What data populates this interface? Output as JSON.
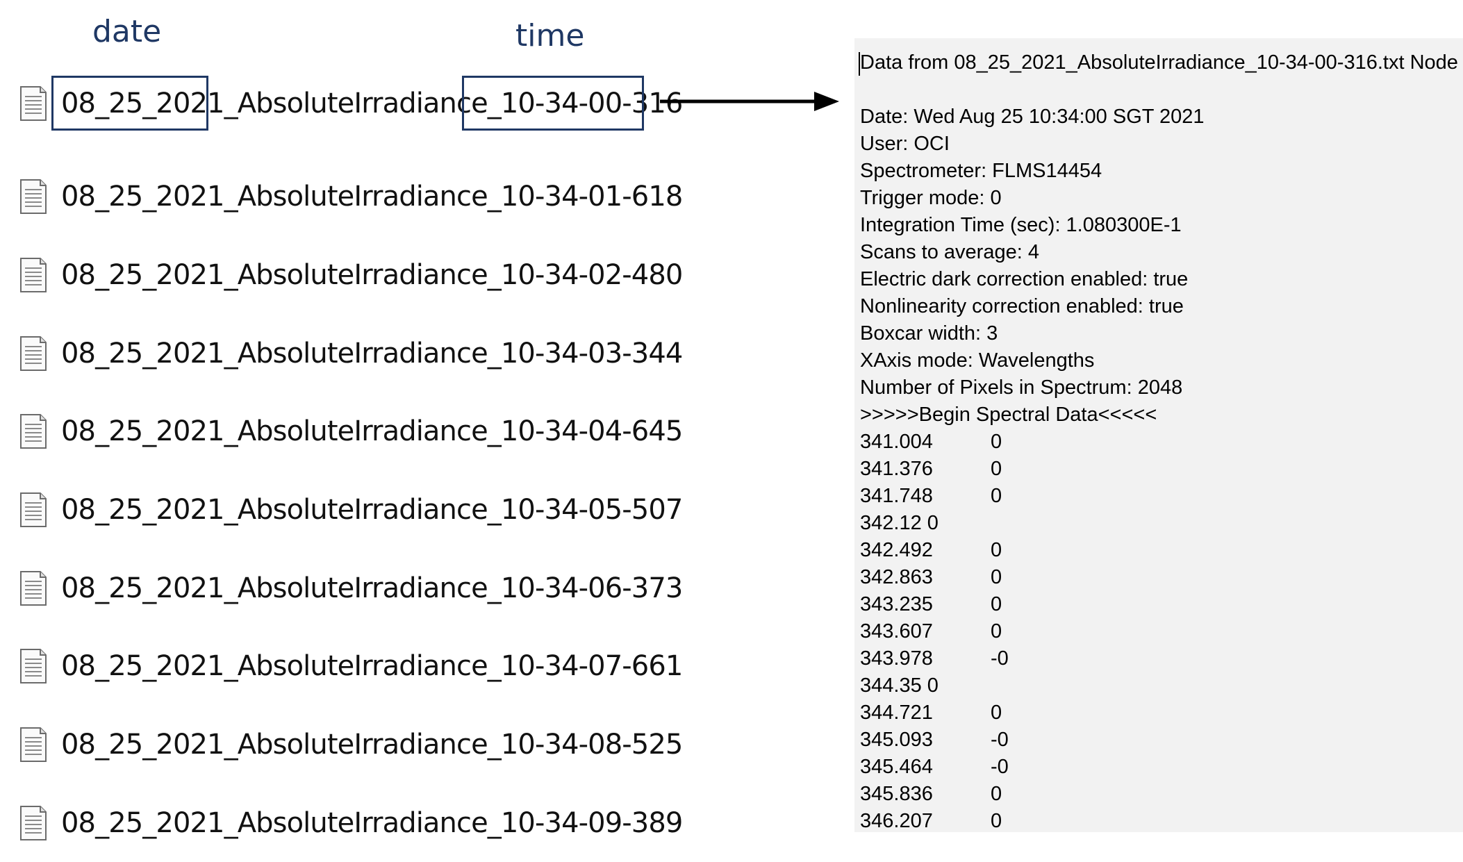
{
  "annotations": {
    "date_label": "date",
    "time_label": "time"
  },
  "files": [
    "08_25_2021_AbsoluteIrradiance_10-34-00-316",
    "08_25_2021_AbsoluteIrradiance_10-34-01-618",
    "08_25_2021_AbsoluteIrradiance_10-34-02-480",
    "08_25_2021_AbsoluteIrradiance_10-34-03-344",
    "08_25_2021_AbsoluteIrradiance_10-34-04-645",
    "08_25_2021_AbsoluteIrradiance_10-34-05-507",
    "08_25_2021_AbsoluteIrradiance_10-34-06-373",
    "08_25_2021_AbsoluteIrradiance_10-34-07-661",
    "08_25_2021_AbsoluteIrradiance_10-34-08-525",
    "08_25_2021_AbsoluteIrradiance_10-34-09-389"
  ],
  "file_icon": "text-document-icon",
  "arrow_icon": "right-arrow-icon",
  "colors": {
    "annotation": "#1f3864",
    "notepad_bg": "#f2f2f2"
  },
  "notepad": {
    "header_lines": [
      "Data from 08_25_2021_AbsoluteIrradiance_10-34-00-316.txt Node",
      "",
      "Date: Wed Aug 25 10:34:00 SGT 2021",
      "User: OCI",
      "Spectrometer: FLMS14454",
      "Trigger mode: 0",
      "Integration Time (sec): 1.080300E-1",
      "Scans to average: 4",
      "Electric dark correction enabled: true",
      "Nonlinearity correction enabled: true",
      "Boxcar width: 3",
      "XAxis mode: Wavelengths",
      "Number of Pixels in Spectrum: 2048",
      ">>>>>Begin Spectral Data<<<<<"
    ],
    "spectral_rows": [
      [
        "341.004",
        "0"
      ],
      [
        "341.376",
        "0"
      ],
      [
        "341.748",
        "0"
      ],
      [
        "342.12 0",
        ""
      ],
      [
        "342.492",
        "0"
      ],
      [
        "342.863",
        "0"
      ],
      [
        "343.235",
        "0"
      ],
      [
        "343.607",
        "0"
      ],
      [
        "343.978",
        "-0"
      ],
      [
        "344.35 0",
        ""
      ],
      [
        "344.721",
        "0"
      ],
      [
        "345.093",
        "-0"
      ],
      [
        "345.464",
        "-0"
      ],
      [
        "345.836",
        "0"
      ],
      [
        "346.207",
        "0"
      ]
    ]
  }
}
